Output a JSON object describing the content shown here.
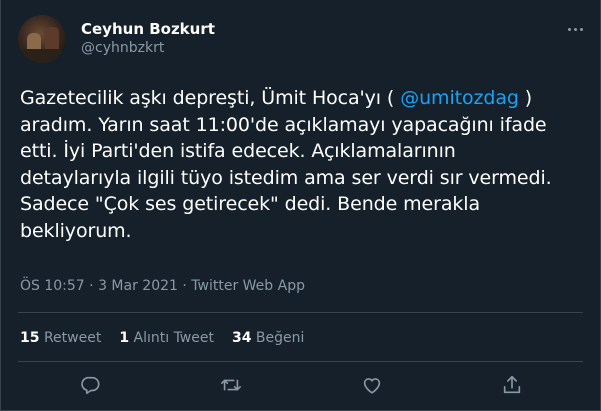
{
  "author": {
    "name": "Ceyhun Bozkurt",
    "handle": "@cyhnbzkrt"
  },
  "tweet": {
    "segments": [
      "Gazetecilik aşkı depreşti, Ümit Hoca'yı ( ",
      "@umitozdag",
      " )",
      "aradım. Yarın saat 11:00'de açıklamayı yapacağını ifade",
      "etti. İyi Parti'den istifa edecek. Açıklamalarının",
      "detaylarıyla ilgili tüyo istedim ama ser verdi sır vermedi.",
      "Sadece \"Çok ses getirecek\" dedi. Bende merakla",
      "bekliyorum."
    ]
  },
  "meta": {
    "time": "ÖS 10:57",
    "date": "3 Mar 2021",
    "source": "Twitter Web App",
    "separator": " · "
  },
  "stats": {
    "retweets_count": "15",
    "retweets_label": "Retweet",
    "quotes_count": "1",
    "quotes_label": "Alıntı Tweet",
    "likes_count": "34",
    "likes_label": "Beğeni"
  },
  "colors": {
    "background": "#15202b",
    "text": "#ffffff",
    "muted": "#8899a6",
    "accent": "#1da1f2",
    "divider": "#38444d"
  },
  "icons": {
    "more": "more-horizontal-icon",
    "reply": "reply-icon",
    "retweet": "retweet-icon",
    "like": "like-icon",
    "share": "share-icon"
  }
}
